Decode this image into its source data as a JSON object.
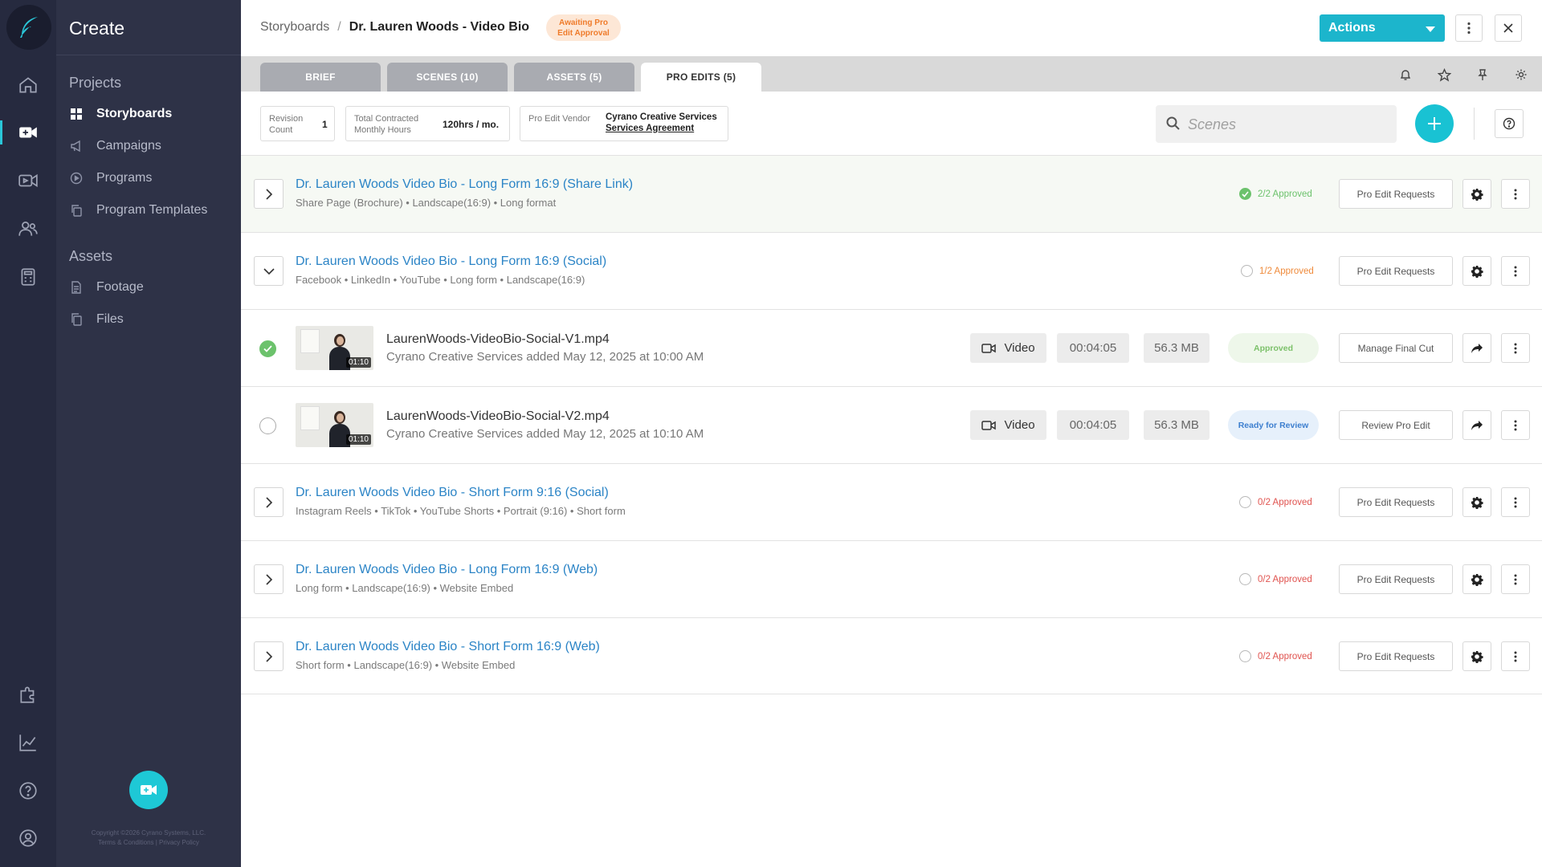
{
  "app": {
    "title": "Create",
    "copyright_line1": "Copyright ©2026 Cyrano Systems, LLC.",
    "copyright_line2": "Terms & Conditions | Privacy Policy"
  },
  "sidebar": {
    "groups": [
      {
        "label": "Projects",
        "items": [
          {
            "label": "Storyboards",
            "icon": "grid-icon",
            "active": true
          },
          {
            "label": "Campaigns",
            "icon": "megaphone-icon"
          },
          {
            "label": "Programs",
            "icon": "play-circle-icon"
          },
          {
            "label": "Program Templates",
            "icon": "copy-icon"
          }
        ]
      },
      {
        "label": "Assets",
        "items": [
          {
            "label": "Footage",
            "icon": "document-icon"
          },
          {
            "label": "Files",
            "icon": "files-icon"
          }
        ]
      }
    ]
  },
  "header": {
    "breadcrumb_root": "Storyboards",
    "breadcrumb_sep": "/",
    "breadcrumb_current": "Dr. Lauren Woods  - Video Bio",
    "status_badge_line1": "Awaiting Pro",
    "status_badge_line2": "Edit Approval",
    "actions_label": "Actions"
  },
  "tabs": [
    {
      "label": "BRIEF"
    },
    {
      "label": "SCENES (10)"
    },
    {
      "label": "ASSETS (5)"
    },
    {
      "label": "PRO EDITS (5)",
      "active": true
    }
  ],
  "info": {
    "revision_label_1": "Revision",
    "revision_label_2": "Count",
    "revision_value": "1",
    "hours_label_1": "Total Contracted",
    "hours_label_2": "Monthly Hours",
    "hours_value": "120hrs / mo.",
    "vendor_label": "Pro Edit Vendor",
    "vendor_name": "Cyrano Creative Services",
    "vendor_agreement": "Services Agreement"
  },
  "search": {
    "placeholder": "Scenes"
  },
  "rows": [
    {
      "kind": "group",
      "title": "Dr. Lauren Woods Video Bio - Long Form 16:9 (Share Link)",
      "sub": "Share Page (Brochure)  •  Landscape(16:9)  •  Long format",
      "status": "2/2 Approved",
      "status_color": "#6cc26c",
      "approved": true,
      "button": "Pro Edit Requests",
      "expanded": false
    },
    {
      "kind": "group",
      "title": "Dr. Lauren Woods Video Bio - Long Form 16:9 (Social)",
      "sub": "Facebook  •  LinkedIn  •  YouTube  •  Long form  •  Landscape(16:9)",
      "status": "1/2 Approved",
      "status_color": "#ef8a3a",
      "approved": false,
      "button": "Pro Edit Requests",
      "expanded": true
    },
    {
      "kind": "file",
      "name": "LaurenWoods-VideoBio-Social-V1.mp4",
      "sub": "Cyrano Creative Services added May 12, 2025 at 10:00 AM",
      "type": "Video",
      "duration": "00:04:05",
      "size": "56.3 MB",
      "thumb_duration": "01:10",
      "state": "Approved",
      "state_kind": "approved",
      "button": "Manage Final Cut",
      "checked": true
    },
    {
      "kind": "file",
      "name": "LaurenWoods-VideoBio-Social-V2.mp4",
      "sub": "Cyrano Creative Services added May 12, 2025 at 10:10 AM",
      "type": "Video",
      "duration": "00:04:05",
      "size": "56.3 MB",
      "thumb_duration": "01:10",
      "state": "Ready for Review",
      "state_kind": "review",
      "button": "Review Pro Edit",
      "checked": false
    },
    {
      "kind": "group",
      "title": "Dr. Lauren Woods Video Bio - Short Form 9:16 (Social)",
      "sub": "Instagram Reels  •  TikTok  •  YouTube Shorts  •  Portrait (9:16)  •  Short form",
      "status": "0/2 Approved",
      "status_color": "#e0534f",
      "approved": false,
      "button": "Pro Edit Requests",
      "expanded": false
    },
    {
      "kind": "group",
      "title": "Dr. Lauren Woods Video Bio - Long Form 16:9 (Web)",
      "sub": "Long form  •  Landscape(16:9)  •  Website Embed",
      "status": "0/2 Approved",
      "status_color": "#e0534f",
      "approved": false,
      "button": "Pro Edit Requests",
      "expanded": false
    },
    {
      "kind": "group",
      "title": "Dr. Lauren Woods Video Bio - Short Form 16:9 (Web)",
      "sub": "Short form  •  Landscape(16:9)  •  Website Embed",
      "status": "0/2 Approved",
      "status_color": "#e0534f",
      "approved": false,
      "button": "Pro Edit Requests",
      "expanded": false
    }
  ],
  "colors": {
    "accent": "#1cb5cc",
    "sidebar": "#2e3247",
    "rail": "#262a3f",
    "link": "#2b84c6"
  }
}
